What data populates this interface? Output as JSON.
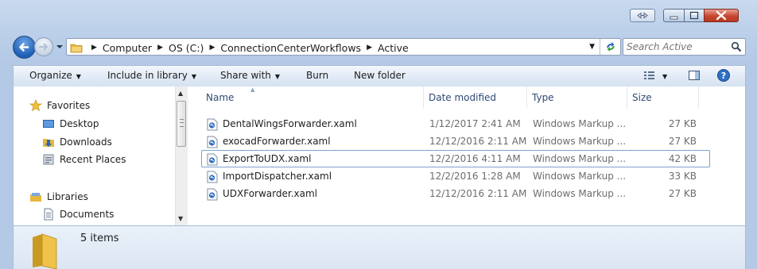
{
  "address": {
    "crumbs": [
      "Computer",
      "OS (C:)",
      "ConnectionCenterWorkflows",
      "Active"
    ]
  },
  "search": {
    "placeholder": "Search Active"
  },
  "toolbar": {
    "organize": "Organize",
    "include_in_library": "Include in library",
    "share_with": "Share with",
    "burn": "Burn",
    "new_folder": "New folder"
  },
  "nav": {
    "favorites": "Favorites",
    "desktop": "Desktop",
    "downloads": "Downloads",
    "recent_places": "Recent Places",
    "libraries": "Libraries",
    "documents": "Documents"
  },
  "columns": {
    "name": "Name",
    "date": "Date modified",
    "type": "Type",
    "size": "Size"
  },
  "files": [
    {
      "name": "DentalWingsForwarder.xaml",
      "date": "1/12/2017 2:41 AM",
      "type": "Windows Markup ...",
      "size": "27 KB"
    },
    {
      "name": "exocadForwarder.xaml",
      "date": "12/12/2016 2:11 AM",
      "type": "Windows Markup ...",
      "size": "27 KB"
    },
    {
      "name": "ExportToUDX.xaml",
      "date": "12/2/2016 4:11 AM",
      "type": "Windows Markup ...",
      "size": "42 KB"
    },
    {
      "name": "ImportDispatcher.xaml",
      "date": "12/2/2016 1:28 AM",
      "type": "Windows Markup ...",
      "size": "33 KB"
    },
    {
      "name": "UDXForwarder.xaml",
      "date": "12/12/2016 2:11 AM",
      "type": "Windows Markup ...",
      "size": "27 KB"
    }
  ],
  "status": {
    "item_count": "5 items"
  },
  "colors": {
    "window_frame": "#b9cde8",
    "header_text": "#2f4a75",
    "close_button": "#c8452f",
    "focus_border": "#7da2ce"
  }
}
